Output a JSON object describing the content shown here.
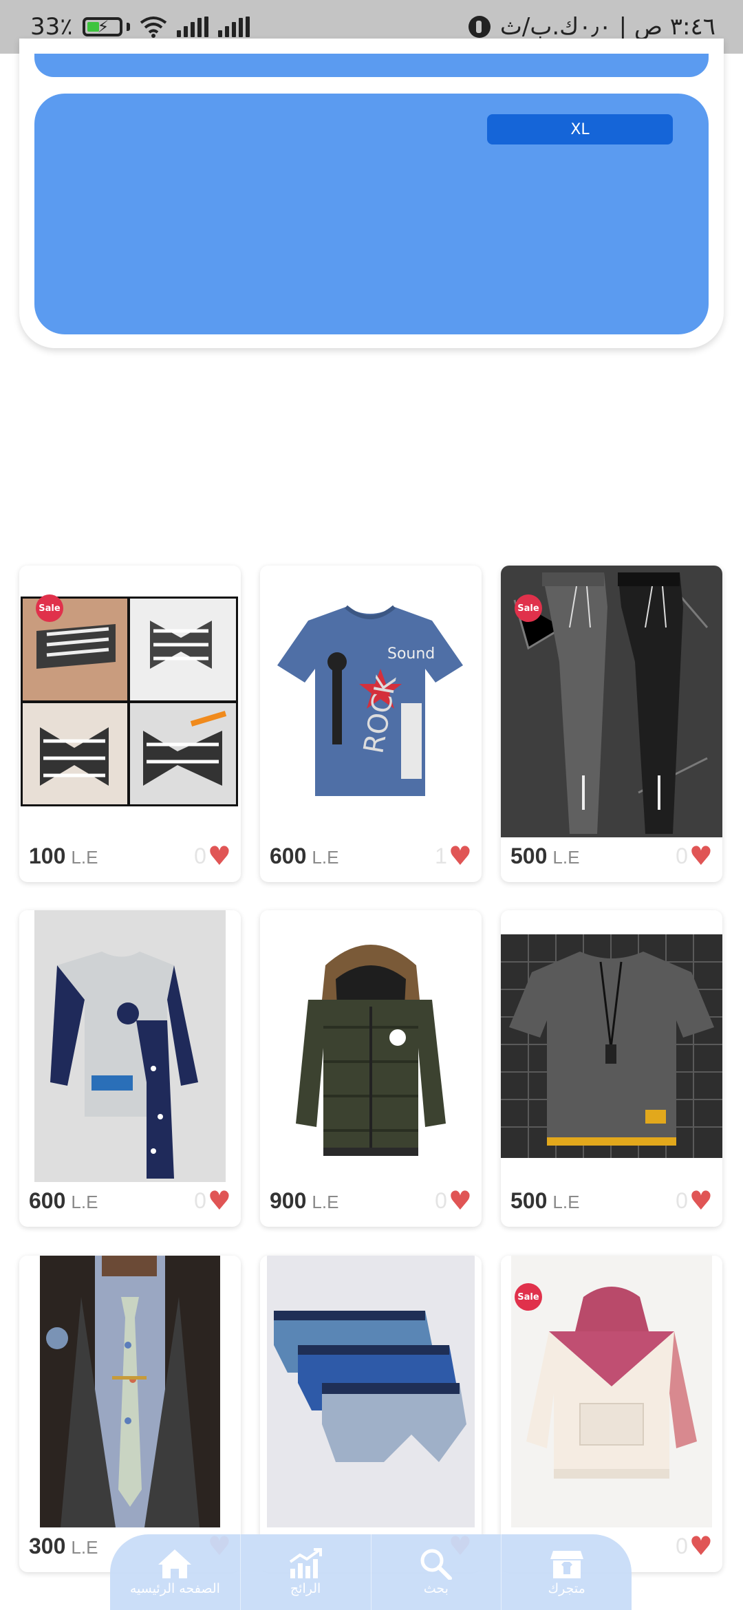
{
  "status_bar": {
    "battery": "33٪",
    "time_text": "٣:٤٦ ص | ٠٫٠ك.ب/ث"
  },
  "top_card": {
    "size_tag": "XL"
  },
  "products": [
    {
      "price": "100",
      "currency": "L.E",
      "likes": "0",
      "sale": true,
      "image": "bow-tie-tutorial"
    },
    {
      "price": "600",
      "currency": "L.E",
      "likes": "1",
      "sale": false,
      "image": "blue-rock-tshirt"
    },
    {
      "price": "500",
      "currency": "L.E",
      "likes": "0",
      "sale": true,
      "image": "gray-black-joggers"
    },
    {
      "price": "600",
      "currency": "L.E",
      "likes": "0",
      "sale": false,
      "image": "kids-pajama-set"
    },
    {
      "price": "900",
      "currency": "L.E",
      "likes": "0",
      "sale": false,
      "image": "kids-puffer-jacket"
    },
    {
      "price": "500",
      "currency": "L.E",
      "likes": "0",
      "sale": false,
      "image": "gray-tshirt"
    },
    {
      "price": "300",
      "currency": "L.E",
      "likes": "",
      "sale": false,
      "image": "suit-floral-tie"
    },
    {
      "price": "",
      "currency": "",
      "likes": "",
      "sale": false,
      "image": "boxer-briefs"
    },
    {
      "price": "",
      "currency": "",
      "likes": "0",
      "sale": true,
      "image": "kids-hoodie"
    }
  ],
  "sale_label": "Sale",
  "bottom_nav": [
    {
      "label": "الصفحه الرئيسيه",
      "icon": "home-icon"
    },
    {
      "label": "الرائج",
      "icon": "trending-chart-icon"
    },
    {
      "label": "بحث",
      "icon": "search-icon"
    },
    {
      "label": "متجرك",
      "icon": "store-icon"
    }
  ],
  "colors": {
    "status_bar": "#c4c4c4",
    "accent_blue": "#5b9bf0",
    "tag_blue": "#1565d8",
    "heart": "#e05555",
    "sale_badge": "#e0314b"
  }
}
